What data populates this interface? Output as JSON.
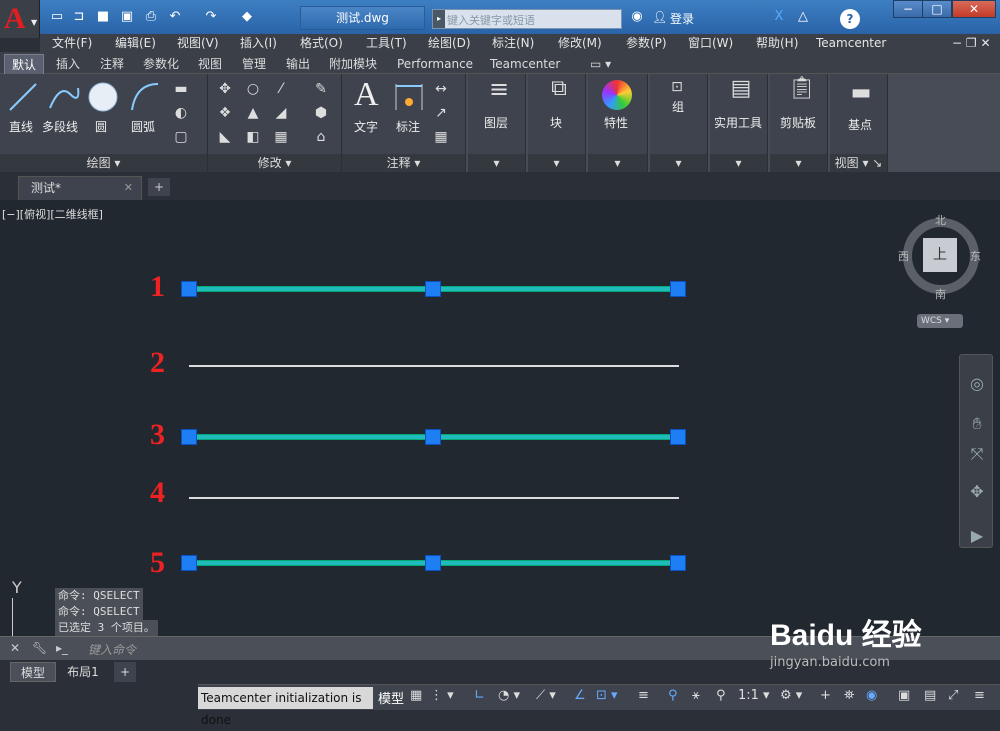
{
  "title_bar": {
    "file_title": "测试.dwg",
    "search_placeholder": "键入关键字或短语",
    "login": "登录",
    "help": "?"
  },
  "menu": [
    "文件(F)",
    "编辑(E)",
    "视图(V)",
    "插入(I)",
    "格式(O)",
    "工具(T)",
    "绘图(D)",
    "标注(N)",
    "修改(M)",
    "参数(P)",
    "窗口(W)",
    "帮助(H)",
    "Teamcenter"
  ],
  "ribbon_tabs": [
    "默认",
    "插入",
    "注释",
    "参数化",
    "视图",
    "管理",
    "输出",
    "附加模块",
    "Performance",
    "Teamcenter"
  ],
  "draw_panel": {
    "line": "直线",
    "polyline": "多段线",
    "circle": "圆",
    "arc": "圆弧",
    "footer": "绘图 ▾"
  },
  "modify_panel": {
    "footer": "修改 ▾"
  },
  "annotation_panel": {
    "text": "文字",
    "dimension": "标注",
    "footer": "注释 ▾"
  },
  "layers": "图层",
  "block": "块",
  "properties": "特性",
  "group": "组",
  "utilities": "实用工具",
  "clipboard": "剪贴板",
  "view_panel": {
    "base": "基点",
    "footer": "视图 ▾ ↘"
  },
  "doc_tab": {
    "name": "测试*",
    "close": "✕",
    "add": "+"
  },
  "viewport_label": "[−][俯视][二维线框]",
  "lines": [
    {
      "num": "1"
    },
    {
      "num": "2"
    },
    {
      "num": "3"
    },
    {
      "num": "4"
    },
    {
      "num": "5"
    }
  ],
  "viewcube": {
    "north": "北",
    "south": "南",
    "east": "东",
    "west": "西",
    "top": "上",
    "wcs": "WCS ▾"
  },
  "ucs": {
    "y": "Y"
  },
  "command_history": [
    "命令: QSELECT",
    "命令: QSELECT",
    "已选定 3 个项目。"
  ],
  "command_placeholder": "键入命令",
  "layout_tabs": [
    "模型",
    "布局1",
    "+"
  ],
  "status": {
    "message": "Teamcenter initialization is done",
    "model": "模型",
    "scale": "1:1 ▾"
  },
  "watermark": {
    "brand": "Baidu 经验",
    "sub": "jingyan.baidu.com"
  }
}
